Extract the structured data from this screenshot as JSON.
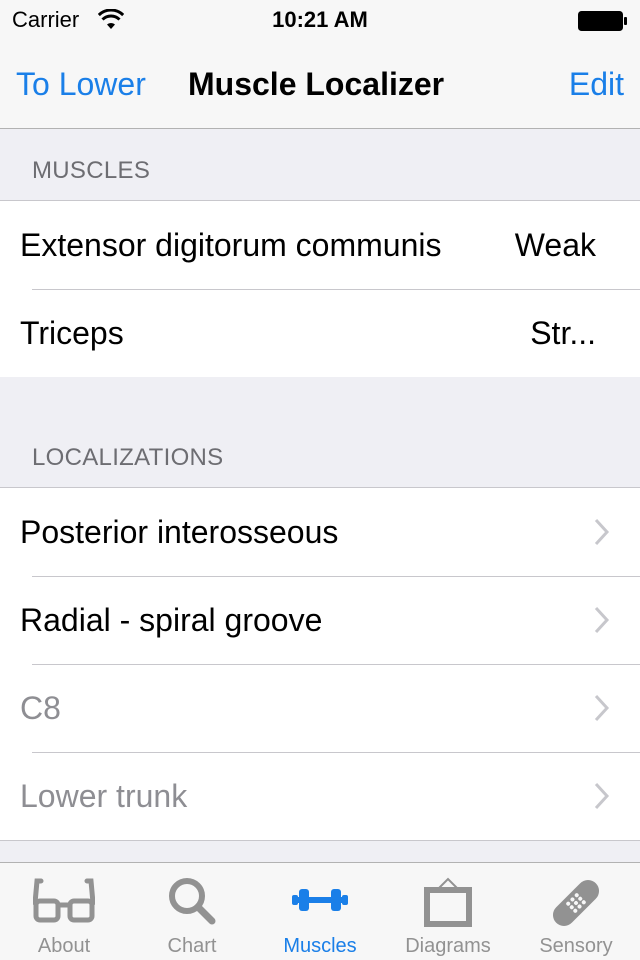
{
  "status_bar": {
    "carrier": "Carrier",
    "time": "10:21 AM"
  },
  "nav": {
    "back_label": "To Lower",
    "title": "Muscle Localizer",
    "edit_label": "Edit"
  },
  "sections": {
    "muscles": {
      "header": "MUSCLES",
      "items": [
        {
          "label": "Extensor digitorum communis",
          "detail": "Weak"
        },
        {
          "label": "Triceps",
          "detail": "Str..."
        }
      ]
    },
    "localizations": {
      "header": "LOCALIZATIONS",
      "items": [
        {
          "label": "Posterior interosseous",
          "dimmed": false
        },
        {
          "label": "Radial - spiral groove",
          "dimmed": false
        },
        {
          "label": "C8",
          "dimmed": true
        },
        {
          "label": "Lower trunk",
          "dimmed": true
        }
      ]
    }
  },
  "tab_bar": {
    "active": "Muscles",
    "tabs": [
      {
        "label": "About",
        "icon": "glasses-icon"
      },
      {
        "label": "Chart",
        "icon": "magnifier-icon"
      },
      {
        "label": "Muscles",
        "icon": "dumbbell-icon"
      },
      {
        "label": "Diagrams",
        "icon": "picture-frame-icon"
      },
      {
        "label": "Sensory",
        "icon": "bandage-icon"
      }
    ]
  },
  "colors": {
    "accent": "#1a7fe8",
    "inactive_tab": "#929292",
    "section_header_text": "#6d6d72",
    "dimmed_text": "#8e8e93",
    "background": "#efeff4"
  }
}
